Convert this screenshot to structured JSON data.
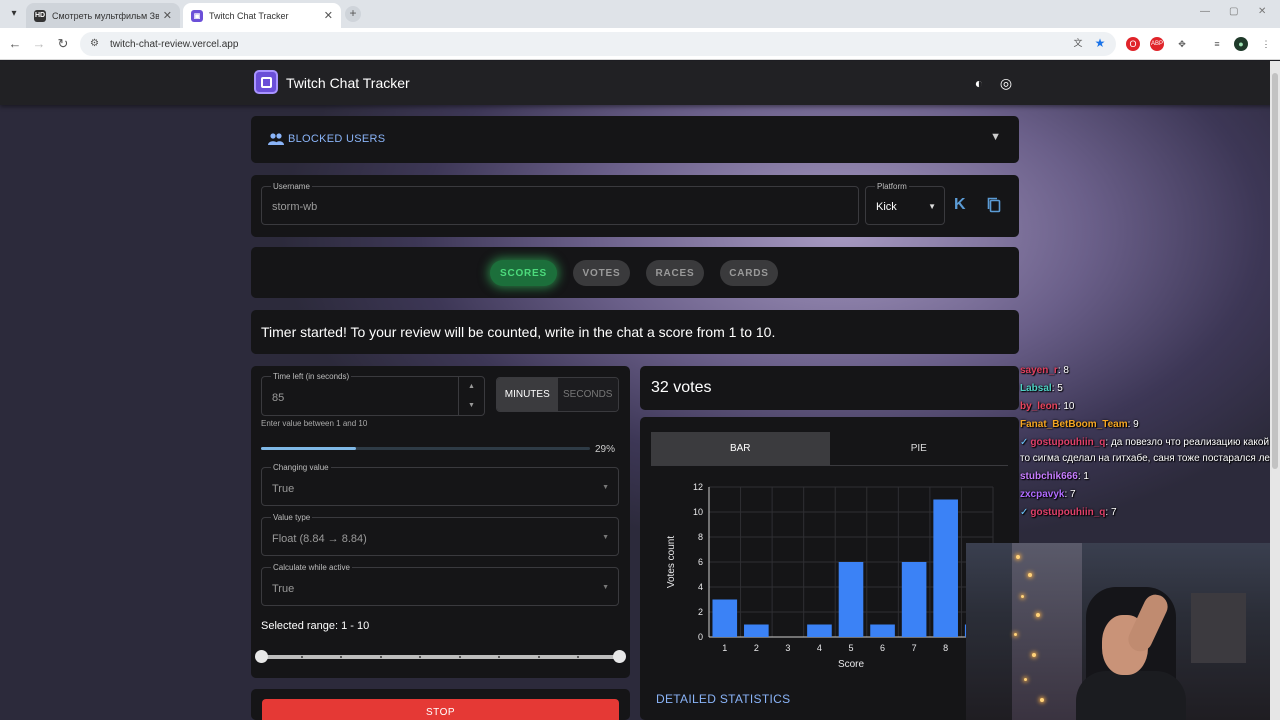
{
  "browser": {
    "tabs": [
      {
        "label": "Смотреть мультфильм Зверопо",
        "badge": "HD"
      },
      {
        "label": "Twitch Chat Tracker"
      }
    ],
    "url": "twitch-chat-review.vercel.app"
  },
  "app": {
    "title": "Twitch Chat Tracker",
    "blocked_users_label": "BLOCKED USERS",
    "username": {
      "label": "Username",
      "value": "storm-wb"
    },
    "platform": {
      "label": "Platform",
      "value": "Kick"
    },
    "modes": [
      "SCORES",
      "VOTES",
      "RACES",
      "CARDS"
    ],
    "active_mode": "SCORES",
    "timer_message": "Timer started! To your review will be counted, write in the chat a score from 1 to 10.",
    "time_left": {
      "label": "Time left (in seconds)",
      "value": "85",
      "helper": "Enter value between 1 and 10"
    },
    "unit_toggle": {
      "minutes": "MINUTES",
      "seconds": "SECONDS",
      "selected": "MINUTES"
    },
    "progress": {
      "percent": 29,
      "label": "29%"
    },
    "changing_value": {
      "label": "Changing value",
      "value": "True"
    },
    "value_type": {
      "label": "Value type",
      "value": "Float (8.84 → 8.84)"
    },
    "calc_while_active": {
      "label": "Calculate while active",
      "value": "True"
    },
    "selected_range": {
      "label": "Selected range: 1 - 10",
      "min": 1,
      "max": 10
    },
    "votes_count": "32 votes",
    "chart_tabs": [
      "BAR",
      "PIE"
    ],
    "active_chart_tab": "BAR",
    "detailed_stats_label": "DETAILED STATISTICS",
    "stop_label": "STOP"
  },
  "chart_data": {
    "type": "bar",
    "categories": [
      "1",
      "2",
      "3",
      "4",
      "5",
      "6",
      "7",
      "8",
      "9"
    ],
    "values": [
      3,
      1,
      0,
      1,
      6,
      1,
      6,
      11,
      1
    ],
    "xlabel": "Score",
    "ylabel": "Votes count",
    "ylim": [
      0,
      12
    ],
    "yticks": [
      "0",
      "2",
      "4",
      "6",
      "8",
      "10",
      "12"
    ],
    "grid": true,
    "bar_color": "#3b82f6"
  },
  "overlay_chat": [
    {
      "user": "sayen_r",
      "text": ": 8",
      "color": "#e04060"
    },
    {
      "user": "Labsal",
      "text": ": 5",
      "color": "#4fd1c5"
    },
    {
      "user": "by_leon",
      "text": ": 10",
      "color": "#e8455f"
    },
    {
      "user": "Fanat_BetBoom_Team",
      "text": ": 9",
      "color": "#f5a623"
    },
    {
      "user": "gostupouhiin_q",
      "text": ": да повезло что реализацию какой то сигма сделал на гитхабе, саня тоже постарался лега",
      "color": "#e0406a",
      "verified": true
    },
    {
      "user": "stubchik666",
      "text": ": 1",
      "color": "#c77dff"
    },
    {
      "user": "zxcpavyk",
      "text": ": 7",
      "color": "#b06bff"
    },
    {
      "user": "gostupouhiin_q",
      "text": ": 7",
      "color": "#e0406a",
      "verified": true
    }
  ]
}
